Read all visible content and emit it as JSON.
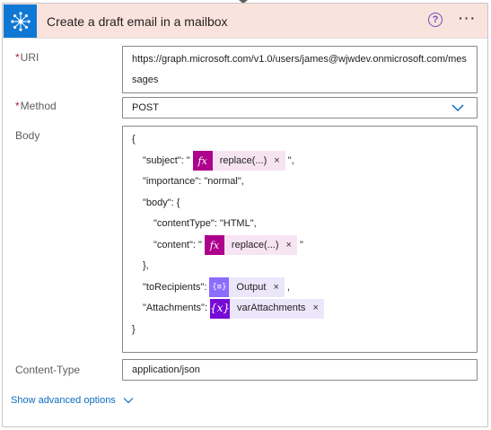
{
  "card": {
    "title": "Create a draft email in a mailbox",
    "help_symbol": "?",
    "more_symbol": "···"
  },
  "uri": {
    "required_marker": "*",
    "label": "URI",
    "value": "https://graph.microsoft.com/v1.0/users/james@wjwdev.onmicrosoft.com/messages"
  },
  "method": {
    "required_marker": "*",
    "label": "Method",
    "value": "POST"
  },
  "body": {
    "label": "Body",
    "lines": {
      "open": "{",
      "subject_key": "\"subject\": \"",
      "subject_token": "replace(...)",
      "subject_end": "\",",
      "importance": "\"importance\": \"normal\",",
      "body_key": "\"body\": {",
      "content_type": "\"contentType\": \"HTML\",",
      "content_key": "\"content\": \"",
      "content_token": "replace(...)",
      "content_end": "\"",
      "body_close": "},",
      "to_key": "\"toRecipients\":",
      "to_token": "Output",
      "to_end": ",",
      "att_key": "\"Attachments\":",
      "att_token": "varAttachments",
      "close": "}"
    },
    "token_remove_symbol": "×",
    "token_icons": {
      "expression": "fx",
      "output": "{≡}",
      "variable": "{x}"
    }
  },
  "content_type": {
    "label": "Content-Type",
    "value": "application/json"
  },
  "advanced_options": {
    "label": "Show advanced options"
  },
  "colors": {
    "header_bg": "#fbe3dd",
    "connector_blue": "#0f78d4",
    "expression_purple": "#ad008c",
    "output_purple": "#8c6cff",
    "variable_purple": "#770bd6",
    "link_blue": "#0f6cbd"
  }
}
